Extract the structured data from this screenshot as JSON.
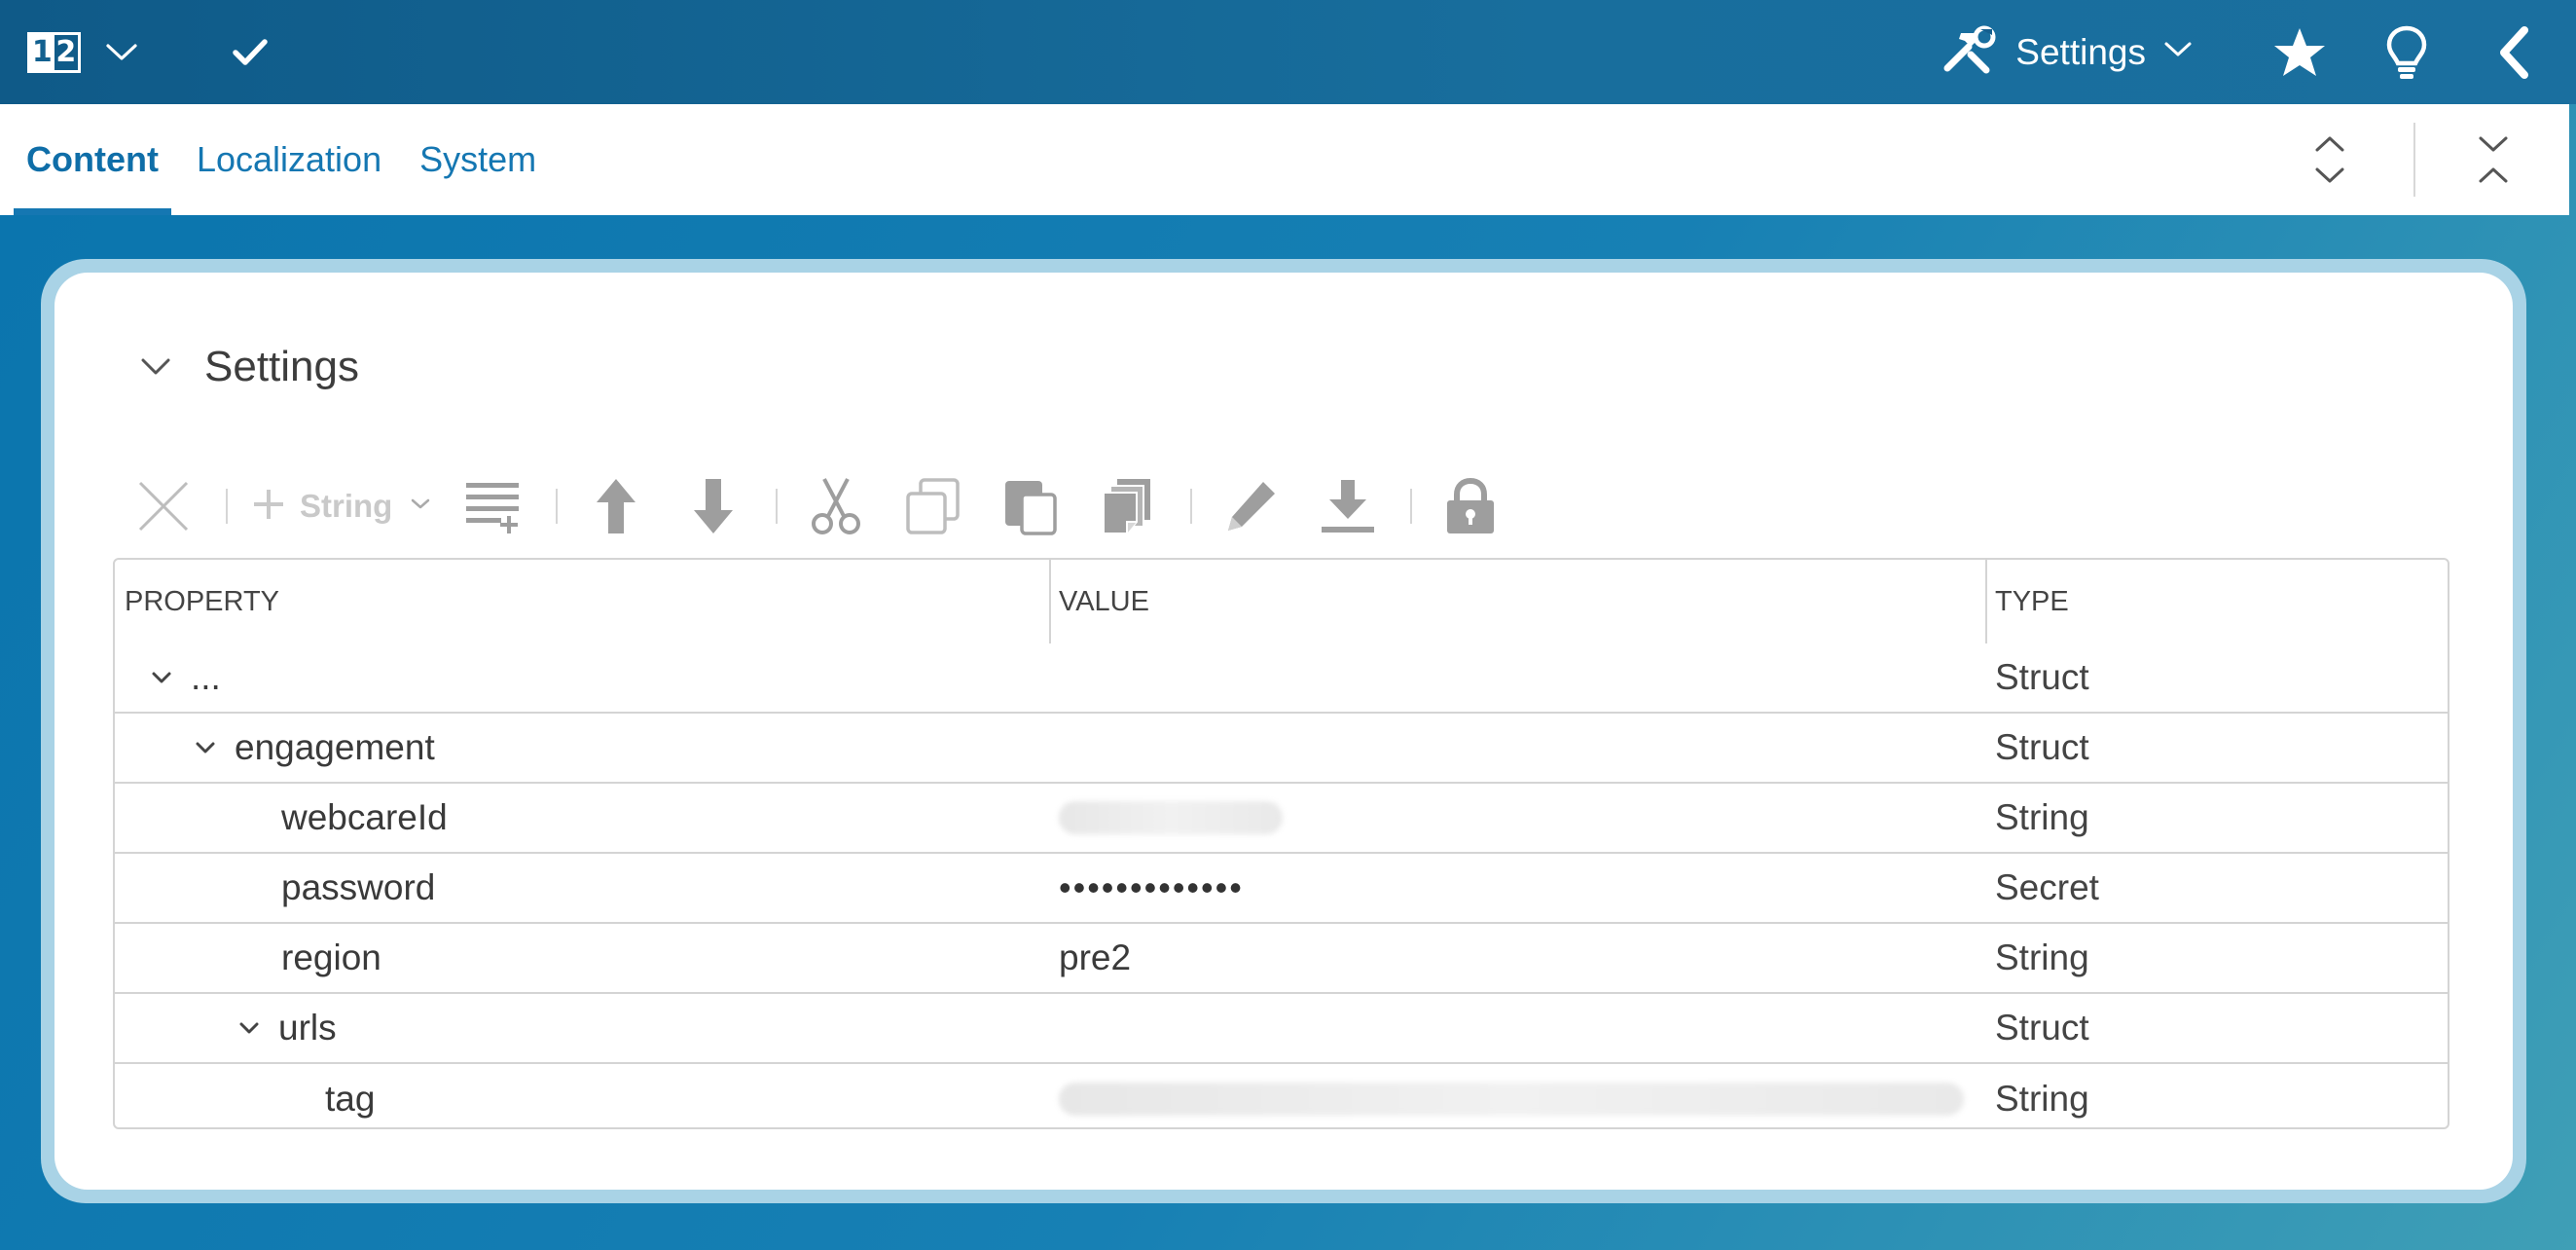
{
  "topbar": {
    "sheet_icon": {
      "left": "1",
      "right": "2"
    },
    "settings_label": "Settings",
    "icons": [
      "sheet-number-icon",
      "chevron-down-icon",
      "check-icon",
      "tools-icon",
      "star-icon",
      "lightbulb-icon",
      "back-arrow-icon"
    ],
    "bg_color": "#155f8e"
  },
  "tabs": [
    {
      "label": "Content",
      "active": true
    },
    {
      "label": "Localization",
      "active": false
    },
    {
      "label": "System",
      "active": false
    }
  ],
  "section": {
    "title": "Settings"
  },
  "editbar": {
    "add_type_label": "String"
  },
  "table": {
    "headers": {
      "property": "PROPERTY",
      "value": "VALUE",
      "type": "TYPE"
    },
    "rows": [
      {
        "property": "...",
        "value": "",
        "type": "Struct",
        "level": 0,
        "expandable": true
      },
      {
        "property": "engagement",
        "value": "",
        "type": "Struct",
        "level": 1,
        "expandable": true
      },
      {
        "property": "webcareId",
        "value": "",
        "type": "String",
        "level": 2,
        "expandable": false,
        "value_blurred": true
      },
      {
        "property": "password",
        "value": "•••••••••••••",
        "type": "Secret",
        "level": 2,
        "expandable": false
      },
      {
        "property": "region",
        "value": "pre2",
        "type": "String",
        "level": 2,
        "expandable": false
      },
      {
        "property": "urls",
        "value": "",
        "type": "Struct",
        "level": 2,
        "expandable": true
      },
      {
        "property": "tag",
        "value": "",
        "type": "String",
        "level": 3,
        "expandable": false,
        "value_blurred": true
      }
    ]
  },
  "colors": {
    "accent": "#1577b2",
    "disabled_icon": "#bdbdbd",
    "panel_frame": "#a9d3e6"
  }
}
